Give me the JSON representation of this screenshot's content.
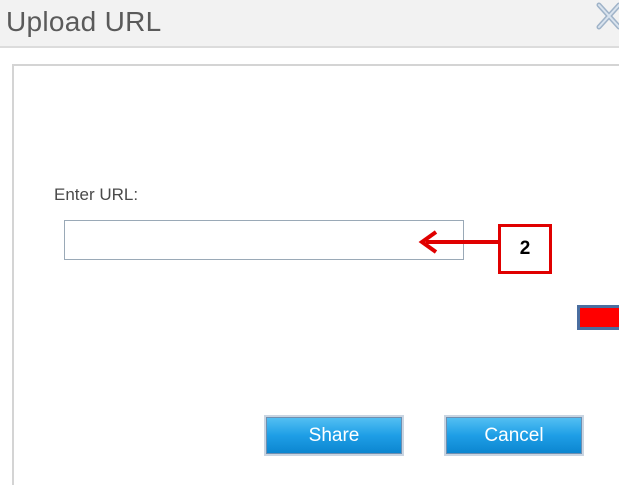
{
  "dialog": {
    "title": "Upload URL",
    "close_icon": "close-x-icon"
  },
  "form": {
    "url_label": "Enter URL:",
    "url_value": "",
    "url_placeholder": ""
  },
  "annotation": {
    "callout_number": "2",
    "arrow_icon": "left-arrow-icon",
    "color": "#e00000"
  },
  "buttons": {
    "share_label": "Share",
    "cancel_label": "Cancel",
    "accent": "#1e9ee6"
  }
}
